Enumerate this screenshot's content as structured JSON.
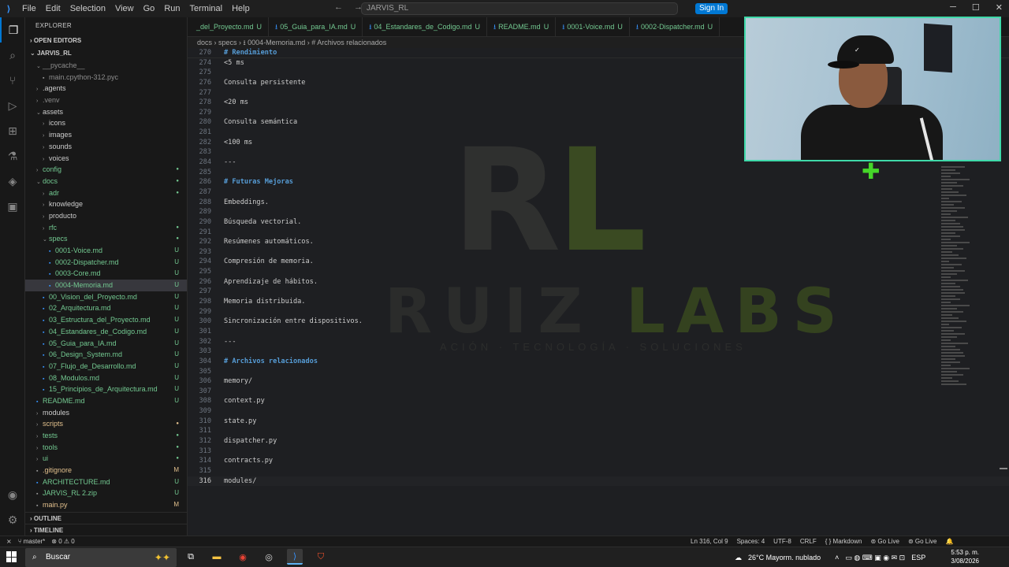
{
  "window": {
    "app_icon": "vscode-icon",
    "menu": [
      "File",
      "Edit",
      "Selection",
      "View",
      "Go",
      "Run",
      "Terminal",
      "Help"
    ],
    "search_text": "JARVIS_RL",
    "signin_label": "Sign In"
  },
  "sidebar": {
    "title": "EXPLORER",
    "open_editors": "OPEN EDITORS",
    "root": "JARVIS_RL",
    "items": [
      {
        "label": "__pycache__",
        "depth": 1,
        "kind": "folder-open",
        "style": "dim",
        "badge": ""
      },
      {
        "label": "main.cpython-312.pyc",
        "depth": 2,
        "kind": "file",
        "style": "dim",
        "badge": ""
      },
      {
        "label": ".agents",
        "depth": 1,
        "kind": "folder",
        "style": "",
        "badge": ""
      },
      {
        "label": ".venv",
        "depth": 1,
        "kind": "folder",
        "style": "dim",
        "badge": ""
      },
      {
        "label": "assets",
        "depth": 1,
        "kind": "folder-open",
        "style": "",
        "badge": ""
      },
      {
        "label": "icons",
        "depth": 2,
        "kind": "folder",
        "style": "",
        "badge": ""
      },
      {
        "label": "images",
        "depth": 2,
        "kind": "folder",
        "style": "",
        "badge": ""
      },
      {
        "label": "sounds",
        "depth": 2,
        "kind": "folder",
        "style": "",
        "badge": ""
      },
      {
        "label": "voices",
        "depth": 2,
        "kind": "folder",
        "style": "",
        "badge": ""
      },
      {
        "label": "config",
        "depth": 1,
        "kind": "folder",
        "style": "new",
        "badge": "dot"
      },
      {
        "label": "docs",
        "depth": 1,
        "kind": "folder-open",
        "style": "new",
        "badge": "dot"
      },
      {
        "label": "adr",
        "depth": 2,
        "kind": "folder",
        "style": "new",
        "badge": "dot"
      },
      {
        "label": "knowledge",
        "depth": 2,
        "kind": "folder",
        "style": "",
        "badge": ""
      },
      {
        "label": "producto",
        "depth": 2,
        "kind": "folder",
        "style": "",
        "badge": ""
      },
      {
        "label": "rfc",
        "depth": 2,
        "kind": "folder",
        "style": "new",
        "badge": "dot"
      },
      {
        "label": "specs",
        "depth": 2,
        "kind": "folder-open",
        "style": "new",
        "badge": "dot"
      },
      {
        "label": "0001-Voice.md",
        "depth": 3,
        "kind": "file",
        "style": "new",
        "badge": "U"
      },
      {
        "label": "0002-Dispatcher.md",
        "depth": 3,
        "kind": "file",
        "style": "new",
        "badge": "U"
      },
      {
        "label": "0003-Core.md",
        "depth": 3,
        "kind": "file",
        "style": "new",
        "badge": "U"
      },
      {
        "label": "0004-Memoria.md",
        "depth": 3,
        "kind": "file",
        "style": "new",
        "badge": "U",
        "selected": true
      },
      {
        "label": "00_Vision_del_Proyecto.md",
        "depth": 2,
        "kind": "file",
        "style": "new",
        "badge": "U"
      },
      {
        "label": "02_Arquitectura.md",
        "depth": 2,
        "kind": "file",
        "style": "new",
        "badge": "U"
      },
      {
        "label": "03_Estructura_del_Proyecto.md",
        "depth": 2,
        "kind": "file",
        "style": "new",
        "badge": "U"
      },
      {
        "label": "04_Estandares_de_Codigo.md",
        "depth": 2,
        "kind": "file",
        "style": "new",
        "badge": "U"
      },
      {
        "label": "05_Guia_para_IA.md",
        "depth": 2,
        "kind": "file",
        "style": "new",
        "badge": "U"
      },
      {
        "label": "06_Design_System.md",
        "depth": 2,
        "kind": "file",
        "style": "new",
        "badge": "U"
      },
      {
        "label": "07_Flujo_de_Desarrollo.md",
        "depth": 2,
        "kind": "file",
        "style": "new",
        "badge": "U"
      },
      {
        "label": "08_Modulos.md",
        "depth": 2,
        "kind": "file",
        "style": "new",
        "badge": "U"
      },
      {
        "label": "15_Principios_de_Arquitectura.md",
        "depth": 2,
        "kind": "file",
        "style": "new",
        "badge": "U"
      },
      {
        "label": "README.md",
        "depth": 1,
        "kind": "file",
        "style": "new",
        "badge": "U"
      },
      {
        "label": "modules",
        "depth": 1,
        "kind": "folder",
        "style": "",
        "badge": ""
      },
      {
        "label": "scripts",
        "depth": 1,
        "kind": "folder",
        "style": "mod",
        "badge": "dot-m"
      },
      {
        "label": "tests",
        "depth": 1,
        "kind": "folder",
        "style": "new",
        "badge": "dot"
      },
      {
        "label": "tools",
        "depth": 1,
        "kind": "folder",
        "style": "new",
        "badge": "dot"
      },
      {
        "label": "ui",
        "depth": 1,
        "kind": "folder",
        "style": "new",
        "badge": "dot"
      },
      {
        "label": ".gitignore",
        "depth": 1,
        "kind": "file",
        "style": "mod",
        "badge": "M"
      },
      {
        "label": "ARCHITECTURE.md",
        "depth": 1,
        "kind": "file",
        "style": "new",
        "badge": "U"
      },
      {
        "label": "JARVIS_RL 2.zip",
        "depth": 1,
        "kind": "file",
        "style": "new",
        "badge": "U"
      },
      {
        "label": "main.py",
        "depth": 1,
        "kind": "file",
        "style": "mod",
        "badge": "M"
      }
    ],
    "outline": "OUTLINE",
    "timeline": "TIMELINE"
  },
  "tabs": [
    {
      "label": "_del_Proyecto.md",
      "badge": "U"
    },
    {
      "label": "05_Guia_para_IA.md",
      "badge": "U"
    },
    {
      "label": "04_Estandares_de_Codigo.md",
      "badge": "U"
    },
    {
      "label": "README.md",
      "badge": "U"
    },
    {
      "label": "0001-Voice.md",
      "badge": "U"
    },
    {
      "label": "0002-Dispatcher.md",
      "badge": "U"
    }
  ],
  "breadcrumb": "docs › specs › ⭳ 0004-Memoria.md › # Archivos relacionados",
  "sticky_header": {
    "num": "270",
    "text": "# Rendimiento"
  },
  "code_lines": [
    {
      "num": "274",
      "text": "<5 ms"
    },
    {
      "num": "275",
      "text": ""
    },
    {
      "num": "276",
      "text": "Consulta persistente"
    },
    {
      "num": "277",
      "text": ""
    },
    {
      "num": "278",
      "text": "<20 ms"
    },
    {
      "num": "279",
      "text": ""
    },
    {
      "num": "280",
      "text": "Consulta semántica"
    },
    {
      "num": "281",
      "text": ""
    },
    {
      "num": "282",
      "text": "<100 ms"
    },
    {
      "num": "283",
      "text": ""
    },
    {
      "num": "284",
      "text": "---"
    },
    {
      "num": "285",
      "text": ""
    },
    {
      "num": "286",
      "text": "# Futuras Mejoras",
      "heading": true
    },
    {
      "num": "287",
      "text": ""
    },
    {
      "num": "288",
      "text": "Embeddings."
    },
    {
      "num": "289",
      "text": ""
    },
    {
      "num": "290",
      "text": "Búsqueda vectorial."
    },
    {
      "num": "291",
      "text": ""
    },
    {
      "num": "292",
      "text": "Resúmenes automáticos."
    },
    {
      "num": "293",
      "text": ""
    },
    {
      "num": "294",
      "text": "Compresión de memoria."
    },
    {
      "num": "295",
      "text": ""
    },
    {
      "num": "296",
      "text": "Aprendizaje de hábitos."
    },
    {
      "num": "297",
      "text": ""
    },
    {
      "num": "298",
      "text": "Memoria distribuida."
    },
    {
      "num": "299",
      "text": ""
    },
    {
      "num": "300",
      "text": "Sincronización entre dispositivos."
    },
    {
      "num": "301",
      "text": ""
    },
    {
      "num": "302",
      "text": "---"
    },
    {
      "num": "303",
      "text": ""
    },
    {
      "num": "304",
      "text": "# Archivos relacionados",
      "heading": true
    },
    {
      "num": "305",
      "text": ""
    },
    {
      "num": "306",
      "text": "memory/"
    },
    {
      "num": "307",
      "text": ""
    },
    {
      "num": "308",
      "text": "context.py"
    },
    {
      "num": "309",
      "text": ""
    },
    {
      "num": "310",
      "text": "state.py"
    },
    {
      "num": "311",
      "text": ""
    },
    {
      "num": "312",
      "text": "dispatcher.py"
    },
    {
      "num": "313",
      "text": ""
    },
    {
      "num": "314",
      "text": "contracts.py"
    },
    {
      "num": "315",
      "text": ""
    },
    {
      "num": "316",
      "text": "modules/",
      "current": true
    }
  ],
  "watermark": {
    "rl": "RL",
    "ruiz": "RUIZ",
    "labs": "LABS",
    "tagline": "ACIÓN · TECNOLOGÍA · SOLUCIONES"
  },
  "status": {
    "branch": "master*",
    "problems": "⊗ 0 ⚠ 0",
    "position": "Ln 316, Col 9",
    "spaces": "Spaces: 4",
    "encoding": "UTF-8",
    "eol": "CRLF",
    "language": "Markdown",
    "golive1": "Go Live",
    "golive2": "Go Live"
  },
  "taskbar": {
    "search_label": "Buscar",
    "weather": "26°C  Mayorm. nublado",
    "lang": "ESP",
    "time": "5:53 p. m.",
    "date": "3/08/2026"
  },
  "colors": {
    "accent": "#0078d4",
    "untracked": "#73c991",
    "modified": "#e2c08d",
    "heading": "#569cd6",
    "webcam_border": "#3fd9a9"
  }
}
